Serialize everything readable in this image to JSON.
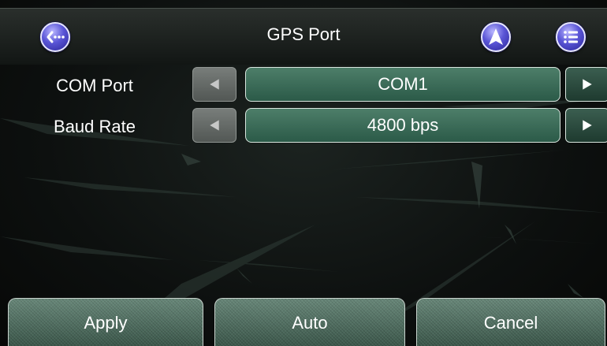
{
  "header": {
    "title": "GPS Port",
    "back_icon": "back-ellipsis-icon",
    "navigate_icon": "navigation-arrow-icon",
    "menu_icon": "list-menu-icon"
  },
  "settings": [
    {
      "label": "COM Port",
      "value": "COM1",
      "prev_icon": "triangle-left-icon",
      "next_icon": "triangle-right-icon"
    },
    {
      "label": "Baud Rate",
      "value": "4800 bps",
      "prev_icon": "triangle-left-icon",
      "next_icon": "triangle-right-icon"
    }
  ],
  "footer": {
    "apply_label": "Apply",
    "auto_label": "Auto",
    "cancel_label": "Cancel"
  },
  "colors": {
    "accent_button": "#5a55d6",
    "value_box": "#3c6b57",
    "background": "#0d100f"
  }
}
